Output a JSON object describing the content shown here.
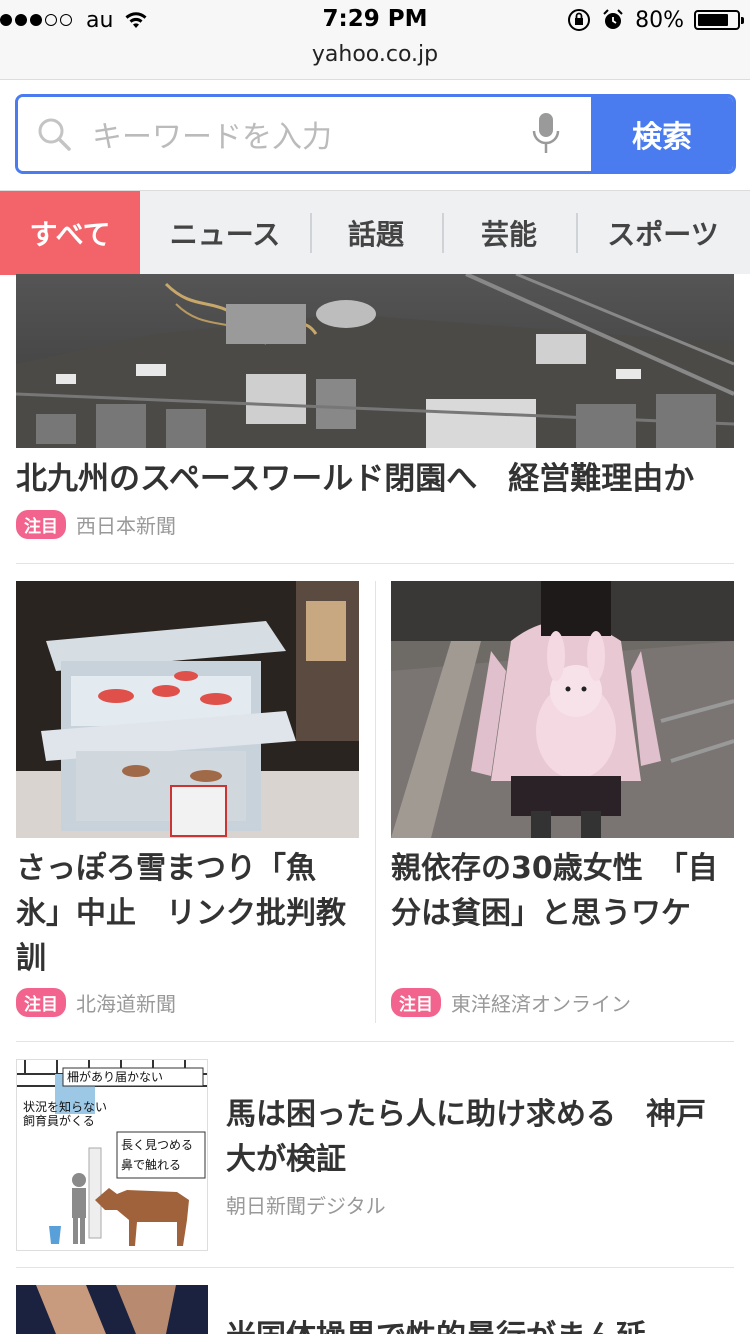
{
  "status": {
    "carrier": "au",
    "time": "7:29 PM",
    "battery": "80%",
    "battery_level": 0.8,
    "signal_bars": 3
  },
  "url": "yahoo.co.jp",
  "search": {
    "placeholder": "キーワードを入力",
    "button": "検索"
  },
  "tabs": [
    "すべて",
    "ニュース",
    "話題",
    "芸能",
    "スポーツ"
  ],
  "articles": [
    {
      "title": "北九州のスペースワールド閉園へ　経営難理由か",
      "badge": "注目",
      "source": "西日本新聞"
    },
    {
      "title": "さっぽろ雪まつり「魚氷」中止　リンク批判教訓",
      "badge": "注目",
      "source": "北海道新聞"
    },
    {
      "title": "親依存の30歳女性　「自分は貧困」と思うワケ",
      "badge": "注目",
      "source": "東洋経済オンライン"
    },
    {
      "title": "馬は困ったら人に助け求める　神戸大が検証",
      "source": "朝日新聞デジタル",
      "figure_labels": [
        "柵があり届かない",
        "状況を知らない飼育員がくる",
        "長く見つめる",
        "鼻で触れる"
      ]
    },
    {
      "title": "米国体操界で性的暴行がまん延"
    }
  ],
  "colors": {
    "accent_blue": "#4a7cf0",
    "active_tab": "#f2646a",
    "badge_pink": "#f2648e"
  }
}
